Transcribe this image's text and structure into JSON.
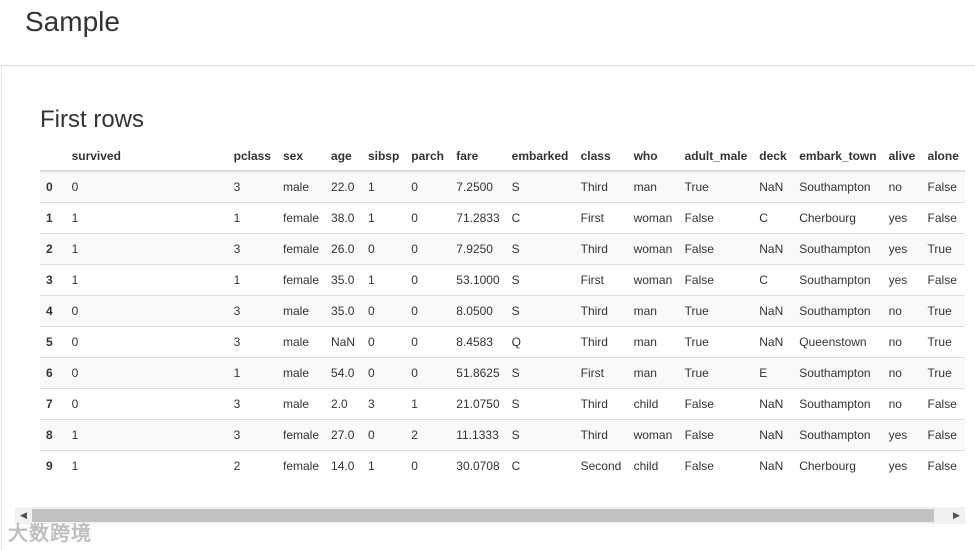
{
  "header": {
    "title": "Sample"
  },
  "section": {
    "title": "First rows"
  },
  "table": {
    "columns": [
      "",
      "survived",
      "pclass",
      "sex",
      "age",
      "sibsp",
      "parch",
      "fare",
      "embarked",
      "class",
      "who",
      "adult_male",
      "deck",
      "embark_town",
      "alive",
      "alone"
    ],
    "rows": [
      [
        "0",
        "0",
        "3",
        "male",
        "22.0",
        "1",
        "0",
        "7.2500",
        "S",
        "Third",
        "man",
        "True",
        "NaN",
        "Southampton",
        "no",
        "False"
      ],
      [
        "1",
        "1",
        "1",
        "female",
        "38.0",
        "1",
        "0",
        "71.2833",
        "C",
        "First",
        "woman",
        "False",
        "C",
        "Cherbourg",
        "yes",
        "False"
      ],
      [
        "2",
        "1",
        "3",
        "female",
        "26.0",
        "0",
        "0",
        "7.9250",
        "S",
        "Third",
        "woman",
        "False",
        "NaN",
        "Southampton",
        "yes",
        "True"
      ],
      [
        "3",
        "1",
        "1",
        "female",
        "35.0",
        "1",
        "0",
        "53.1000",
        "S",
        "First",
        "woman",
        "False",
        "C",
        "Southampton",
        "yes",
        "False"
      ],
      [
        "4",
        "0",
        "3",
        "male",
        "35.0",
        "0",
        "0",
        "8.0500",
        "S",
        "Third",
        "man",
        "True",
        "NaN",
        "Southampton",
        "no",
        "True"
      ],
      [
        "5",
        "0",
        "3",
        "male",
        "NaN",
        "0",
        "0",
        "8.4583",
        "Q",
        "Third",
        "man",
        "True",
        "NaN",
        "Queenstown",
        "no",
        "True"
      ],
      [
        "6",
        "0",
        "1",
        "male",
        "54.0",
        "0",
        "0",
        "51.8625",
        "S",
        "First",
        "man",
        "True",
        "E",
        "Southampton",
        "no",
        "True"
      ],
      [
        "7",
        "0",
        "3",
        "male",
        "2.0",
        "3",
        "1",
        "21.0750",
        "S",
        "Third",
        "child",
        "False",
        "NaN",
        "Southampton",
        "no",
        "False"
      ],
      [
        "8",
        "1",
        "3",
        "female",
        "27.0",
        "0",
        "2",
        "11.1333",
        "S",
        "Third",
        "woman",
        "False",
        "NaN",
        "Southampton",
        "yes",
        "False"
      ],
      [
        "9",
        "1",
        "2",
        "female",
        "14.0",
        "1",
        "0",
        "30.0708",
        "C",
        "Second",
        "child",
        "False",
        "NaN",
        "Cherbourg",
        "yes",
        "False"
      ]
    ]
  },
  "scrollbar": {
    "left_icon": "scroll-left-arrow-icon",
    "right_icon": "scroll-right-arrow-icon"
  },
  "watermark": {
    "text": "大数跨境"
  }
}
